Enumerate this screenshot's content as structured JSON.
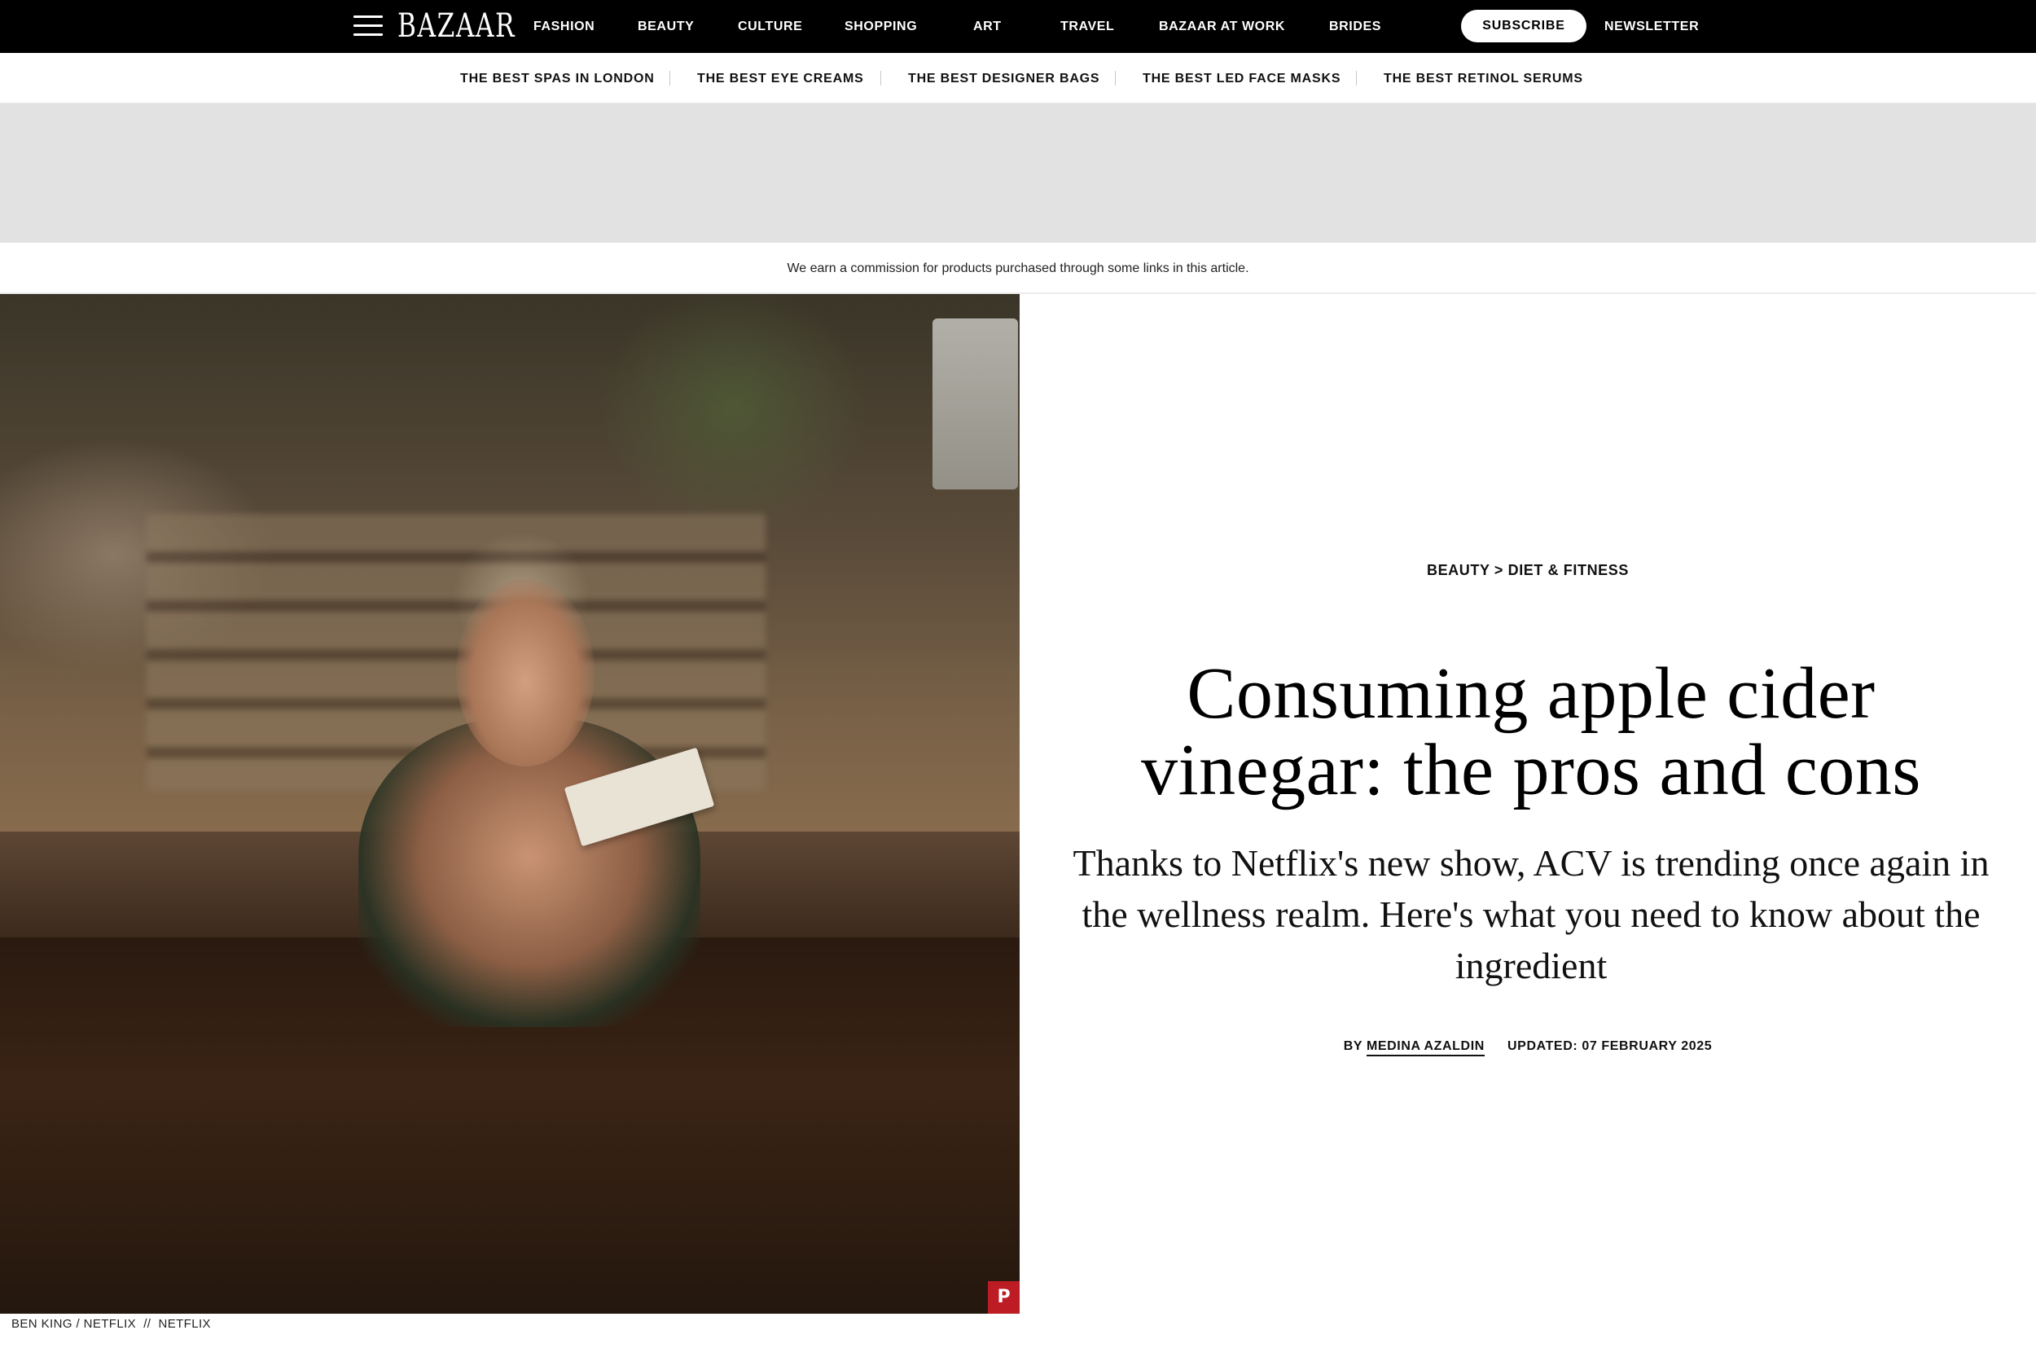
{
  "topbar": {
    "logo": "BAZAAR",
    "nav": [
      {
        "label": "FASHION"
      },
      {
        "label": "BEAUTY"
      },
      {
        "label": "CULTURE"
      },
      {
        "label": "SHOPPING"
      },
      {
        "label": "ART"
      },
      {
        "label": "TRAVEL"
      },
      {
        "label": "BAZAAR AT WORK"
      },
      {
        "label": "BRIDES"
      }
    ],
    "subscribe_label": "SUBSCRIBE",
    "newsletter_label": "NEWSLETTER"
  },
  "subnav": [
    {
      "label": "THE BEST SPAS IN LONDON"
    },
    {
      "label": "THE BEST EYE CREAMS"
    },
    {
      "label": "THE BEST DESIGNER BAGS"
    },
    {
      "label": "THE BEST LED FACE MASKS"
    },
    {
      "label": "THE BEST RETINOL SERUMS"
    }
  ],
  "disclosure": "We earn a commission for products purchased through some links in this article.",
  "hero": {
    "credit": "BEN KING / NETFLIX  //  NETFLIX",
    "pin_icon": "pinterest-icon"
  },
  "article": {
    "breadcrumb": {
      "section": "BEAUTY",
      "separator": ">",
      "subsection": "DIET & FITNESS"
    },
    "title": "Consuming apple cider vinegar: the pros and cons",
    "dek": "Thanks to Netflix's new show, ACV is trending once again in the wellness realm. Here's what you need to know about the ingredient",
    "byline": {
      "by": "BY",
      "author": "MEDINA AZALDIN",
      "updated": "UPDATED: 07 FEBRUARY 2025"
    }
  }
}
